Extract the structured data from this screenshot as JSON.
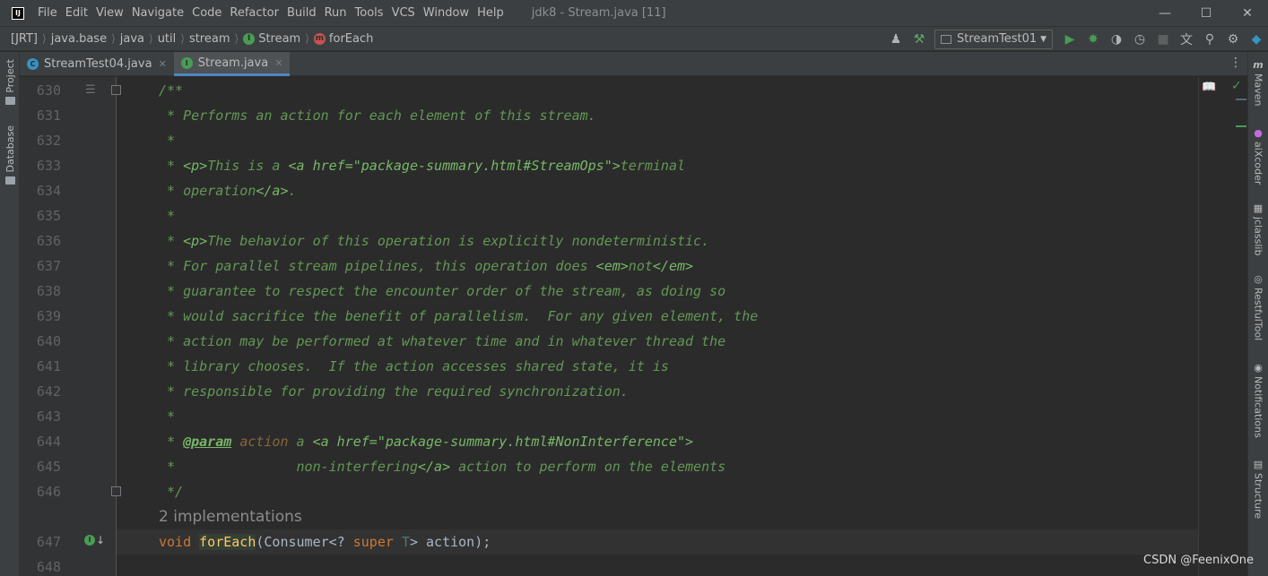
{
  "menubar": {
    "logo": "IJ",
    "items": [
      "File",
      "Edit",
      "View",
      "Navigate",
      "Code",
      "Refactor",
      "Build",
      "Run",
      "Tools",
      "VCS",
      "Window",
      "Help"
    ],
    "title": "jdk8 - Stream.java [11]"
  },
  "breadcrumbs": {
    "items": [
      "[JRT]",
      "java.base",
      "java",
      "util",
      "stream",
      "Stream",
      "forEach"
    ]
  },
  "toolbar": {
    "run_config": "StreamTest01"
  },
  "tabs": [
    {
      "label": "StreamTest04.java",
      "active": false
    },
    {
      "label": "Stream.java",
      "active": true
    }
  ],
  "left_tools": [
    "Project",
    "Database"
  ],
  "right_tools": [
    "Maven",
    "aiXcoder",
    "jclasslib",
    "RestfulTool",
    "Notifications",
    "Structure"
  ],
  "editor": {
    "line_numbers": [
      "630",
      "631",
      "632",
      "633",
      "634",
      "635",
      "636",
      "637",
      "638",
      "639",
      "640",
      "641",
      "642",
      "643",
      "644",
      "645",
      "646",
      "647",
      "648"
    ],
    "lines": {
      "l630": "/**",
      "l631": " * Performs an action for each element of this stream.",
      "l632": " *",
      "l633a": " * ",
      "l633b": "<p>",
      "l633c": "This is a ",
      "l633d": "<a href=\"package-summary.html#StreamOps\">",
      "l633e": "terminal",
      "l634a": " * operation",
      "l634b": "</a>",
      "l634c": ".",
      "l635": " *",
      "l636a": " * ",
      "l636b": "<p>",
      "l636c": "The behavior of this operation is explicitly nondeterministic.",
      "l637a": " * For parallel stream pipelines, this operation does ",
      "l637b": "<em>",
      "l637c": "not",
      "l637d": "</em>",
      "l638": " * guarantee to respect the encounter order of the stream, as doing so",
      "l639": " * would sacrifice the benefit of parallelism.  For any given element, the",
      "l640": " * action may be performed at whatever time and in whatever thread the",
      "l641": " * library chooses.  If the action accesses shared state, it is",
      "l642": " * responsible for providing the required synchronization.",
      "l643": " *",
      "l644a": " * ",
      "l644b": "@param",
      "l644c": " ",
      "l644d": "action",
      "l644e": " a ",
      "l644f": "<a href=\"package-summary.html#NonInterference\">",
      "l645a": " *               non-interfering",
      "l645b": "</a>",
      "l645c": " action to perform on the elements",
      "l646": " */",
      "l647a": "void ",
      "l647b": "forEach",
      "l647c": "(Consumer<? ",
      "l647d": "super ",
      "l647e": "T",
      "l647f": "> action);"
    },
    "implementations_hint": "2 implementations"
  },
  "watermark": "CSDN @FeenixOne",
  "colors": {
    "doc_comment": "#629755",
    "doc_tag": "#77b767",
    "keyword": "#cc7832",
    "method": "#ffc66d",
    "accent": "#4a88c7"
  }
}
